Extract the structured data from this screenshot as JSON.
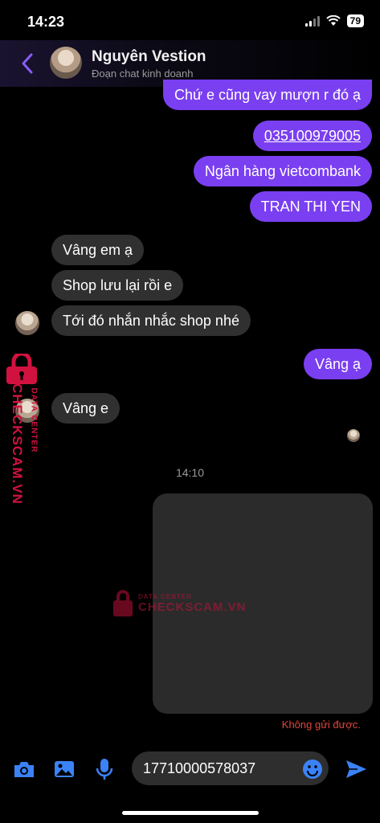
{
  "status": {
    "time": "14:23",
    "battery": "79"
  },
  "header": {
    "name": "Nguyên Vestion",
    "subtitle": "Đoạn chat kinh doanh"
  },
  "messages": {
    "m1": "Chứ e cũng vay mượn r đó ạ",
    "m2": "035100979005",
    "m3": "Ngân hàng vietcombank",
    "m4": "TRAN THI YEN",
    "m5": "Vâng em ạ",
    "m6": "Shop lưu lại rồi e",
    "m7": "Tới đó nhắn nhắc shop nhé",
    "m8": "Vâng ạ",
    "m9": "Vâng e"
  },
  "time_separator": "14:10",
  "failed_text": "Không gửi được.",
  "watermark": {
    "brand": "CHECKSCAM.VN",
    "tag": "DATA CENTER"
  },
  "composer": {
    "value": "17710000578037"
  },
  "colors": {
    "outgoing": "#7a3ff0",
    "incoming": "#303030",
    "accent": "#3b82f6",
    "error": "#e0463d"
  },
  "icons": [
    "back-icon",
    "camera-icon",
    "image-icon",
    "mic-icon",
    "emoji-icon",
    "send-icon"
  ]
}
